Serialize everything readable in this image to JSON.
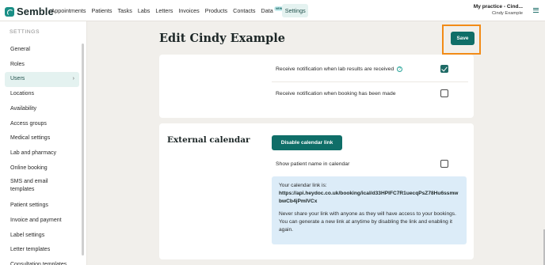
{
  "app": {
    "logo_text": "Semble",
    "practice_name": "My practice - Cind...",
    "practice_user": "Cindy Example"
  },
  "nav": {
    "items": [
      {
        "label": "Appointments"
      },
      {
        "label": "Patients"
      },
      {
        "label": "Tasks"
      },
      {
        "label": "Labs"
      },
      {
        "label": "Letters"
      },
      {
        "label": "Invoices"
      },
      {
        "label": "Products"
      },
      {
        "label": "Contacts"
      },
      {
        "label": "Data",
        "badge": "NEW"
      },
      {
        "label": "Settings",
        "active": true
      }
    ]
  },
  "sidebar": {
    "heading": "SETTINGS",
    "items": [
      {
        "label": "General"
      },
      {
        "label": "Roles"
      },
      {
        "label": "Users",
        "active": true
      },
      {
        "label": "Locations"
      },
      {
        "label": "Availability"
      },
      {
        "label": "Access groups"
      },
      {
        "label": "Medical settings"
      },
      {
        "label": "Lab and pharmacy"
      },
      {
        "label": "Online booking"
      },
      {
        "label": "SMS and email templates"
      },
      {
        "label": "Patient settings"
      },
      {
        "label": "Invoice and payment"
      },
      {
        "label": "Label settings"
      },
      {
        "label": "Letter templates"
      },
      {
        "label": "Consultation templates"
      }
    ]
  },
  "page": {
    "title": "Edit Cindy Example",
    "save_label": "Save"
  },
  "notifications": {
    "lab_results_label": "Receive notification when lab results are received",
    "lab_results_help": "?",
    "lab_results_checked": true,
    "booking_label": "Receive notification when booking has been made",
    "booking_checked": false
  },
  "external_calendar": {
    "title": "External calendar",
    "disable_label": "Disable calendar link",
    "show_name_label": "Show patient name in calendar",
    "show_name_checked": false,
    "link_intro": "Your calendar link is:",
    "link_url": "https://api.heydoc.co.uk/booking/ical/d33HPIFC7R1uecqPsZ78Hu6ssmwbwCb4jPmIVCx",
    "warning": "Never share your link with anyone as they will have access to your bookings. You can generate a new link at anytime by disabling the link and enabling it again."
  },
  "colors": {
    "brand": "#0f6e68",
    "highlight": "#f28b17",
    "info_bg": "#dcecf8"
  }
}
